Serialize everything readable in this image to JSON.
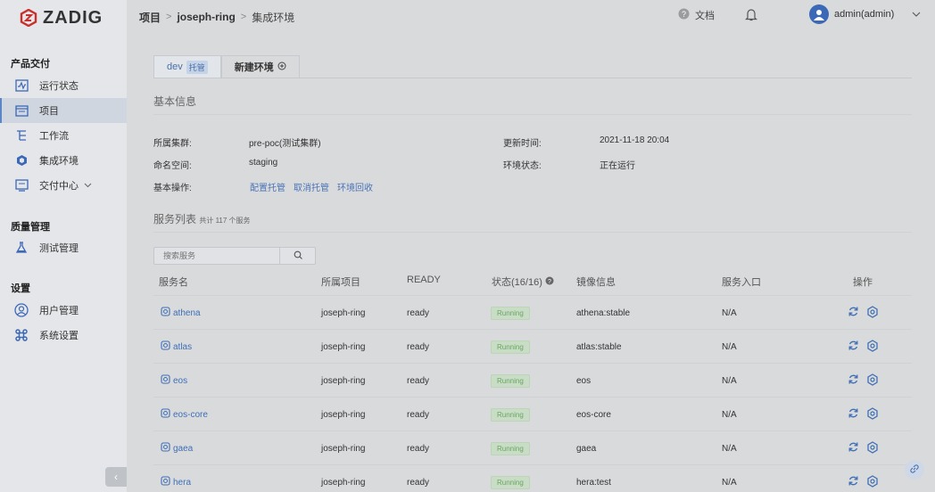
{
  "brand": {
    "name": "ZADIG"
  },
  "sidebar": {
    "groups": [
      {
        "title": "产品交付",
        "items": [
          {
            "label": "运行状态",
            "icon": "dashboard-icon"
          },
          {
            "label": "项目",
            "icon": "project-icon",
            "active": true
          },
          {
            "label": "工作流",
            "icon": "workflow-icon"
          },
          {
            "label": "集成环境",
            "icon": "environment-icon"
          },
          {
            "label": "交付中心",
            "icon": "delivery-icon"
          }
        ]
      },
      {
        "title": "质量管理",
        "items": [
          {
            "label": "测试管理",
            "icon": "test-flask-icon"
          }
        ]
      },
      {
        "title": "设置",
        "items": [
          {
            "label": "用户管理",
            "icon": "user-icon"
          },
          {
            "label": "系统设置",
            "icon": "system-settings-icon"
          }
        ]
      }
    ]
  },
  "breadcrumb": {
    "root": "项目",
    "project": "joseph-ring",
    "current": "集成环境"
  },
  "topbar": {
    "docs": "文档",
    "user": "admin(admin)"
  },
  "tabs": [
    {
      "label": "dev",
      "tag": "托管",
      "active": true
    },
    {
      "label": "新建环境"
    }
  ],
  "basic": {
    "title": "基本信息",
    "cluster_label": "所属集群:",
    "cluster_value": "pre-poc(测试集群)",
    "namespace_label": "命名空间:",
    "namespace_value": "staging",
    "ops_label": "基本操作:",
    "ops": [
      "配置托管",
      "取消托管",
      "环境回收"
    ],
    "updated_label": "更新时间:",
    "updated_value": "2021-11-18 20:04",
    "status_label": "环境状态:",
    "status_value": "正在运行"
  },
  "services": {
    "title": "服务列表",
    "count_text": "共计 117 个服务",
    "search_placeholder": "搜索服务",
    "columns": [
      "服务名",
      "所属项目",
      "READY",
      "状态(16/16)",
      "镜像信息",
      "服务入口",
      "操作"
    ],
    "rows": [
      {
        "name": "athena",
        "project": "joseph-ring",
        "ready": "ready",
        "status": "Running",
        "image": "athena:stable",
        "entry": "N/A"
      },
      {
        "name": "atlas",
        "project": "joseph-ring",
        "ready": "ready",
        "status": "Running",
        "image": "atlas:stable",
        "entry": "N/A"
      },
      {
        "name": "eos",
        "project": "joseph-ring",
        "ready": "ready",
        "status": "Running",
        "image": "eos",
        "entry": "N/A"
      },
      {
        "name": "eos-core",
        "project": "joseph-ring",
        "ready": "ready",
        "status": "Running",
        "image": "eos-core",
        "entry": "N/A"
      },
      {
        "name": "gaea",
        "project": "joseph-ring",
        "ready": "ready",
        "status": "Running",
        "image": "gaea",
        "entry": "N/A"
      },
      {
        "name": "hera",
        "project": "joseph-ring",
        "ready": "ready",
        "status": "Running",
        "image": "hera:test",
        "entry": "N/A"
      }
    ]
  },
  "colors": {
    "accent": "#4a74b7",
    "running": "#6aa663",
    "brand": "#d9534f"
  }
}
